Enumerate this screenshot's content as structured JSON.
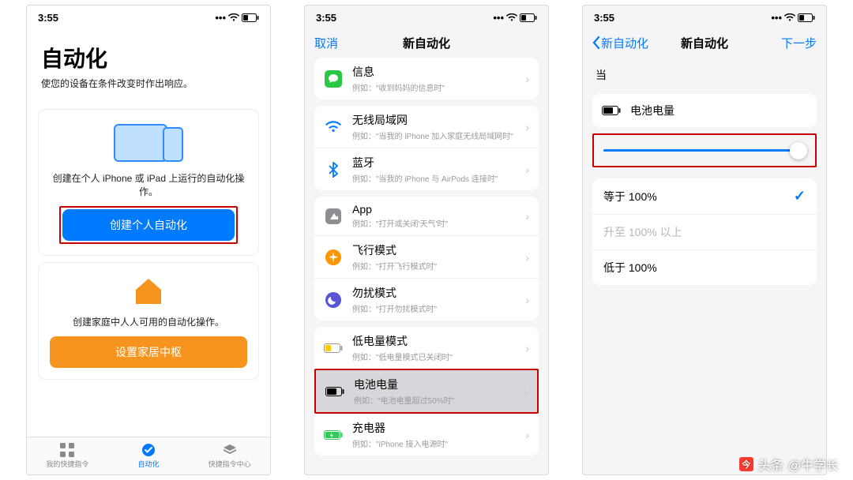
{
  "status": {
    "time": "3:55"
  },
  "colors": {
    "blue": "#007aff",
    "orange": "#f7941e",
    "red": "#c80000"
  },
  "screen1": {
    "title": "自动化",
    "subtitle": "使您的设备在条件改变时作出响应。",
    "personal_caption": "创建在个人 iPhone 或 iPad 上运行的自动化操作。",
    "personal_button": "创建个人自动化",
    "home_caption": "创建家庭中人人可用的自动化操作。",
    "home_button": "设置家居中枢",
    "tabs": [
      {
        "label": "我的快捷指令"
      },
      {
        "label": "自动化"
      },
      {
        "label": "快捷指令中心"
      }
    ]
  },
  "screen2": {
    "nav_left": "取消",
    "nav_title": "新自动化",
    "rows": [
      {
        "icon": "message-icon",
        "iconColor": "#28c840",
        "label": "信息",
        "sub": "例如：\"收到妈妈的信息时\""
      },
      {
        "icon": "wifi-icon",
        "iconColor": "#007aff",
        "label": "无线局域网",
        "sub": "例如：\"当我的 iPhone 加入家庭无线局域网时\""
      },
      {
        "icon": "bluetooth-icon",
        "iconColor": "#007aff",
        "label": "蓝牙",
        "sub": "例如：\"当我的 iPhone 与 AirPods 连接时\""
      },
      {
        "icon": "app-icon",
        "iconColor": "#8e8e93",
        "label": "App",
        "sub": "例如：\"打开或关闭'天气'时\""
      },
      {
        "icon": "airplane-icon",
        "iconColor": "#ff9500",
        "label": "飞行模式",
        "sub": "例如：\"打开飞行模式时\""
      },
      {
        "icon": "dnd-icon",
        "iconColor": "#5856d6",
        "label": "勿扰模式",
        "sub": "例如：\"打开勿扰模式时\""
      },
      {
        "icon": "lowpower-icon",
        "iconColor": "#ffcc00",
        "label": "低电量模式",
        "sub": "例如：\"低电量模式已关闭时\""
      },
      {
        "icon": "battery-icon",
        "iconColor": "#000000",
        "label": "电池电量",
        "sub": "例如：\"电池电量超过50%时\""
      },
      {
        "icon": "charger-icon",
        "iconColor": "#34c759",
        "label": "充电器",
        "sub": "例如：\"iPhone 接入电源时\""
      }
    ]
  },
  "screen3": {
    "nav_back": "新自动化",
    "nav_title": "新自动化",
    "nav_next": "下一步",
    "when_label": "当",
    "trigger_label": "电池电量",
    "slider_value": 100,
    "options": [
      {
        "label": "等于 100%",
        "selected": true,
        "enabled": true
      },
      {
        "label": "升至 100% 以上",
        "selected": false,
        "enabled": false
      },
      {
        "label": "低于 100%",
        "selected": false,
        "enabled": true
      }
    ]
  },
  "watermark": {
    "prefix": "头条",
    "handle": "@牛学长"
  }
}
